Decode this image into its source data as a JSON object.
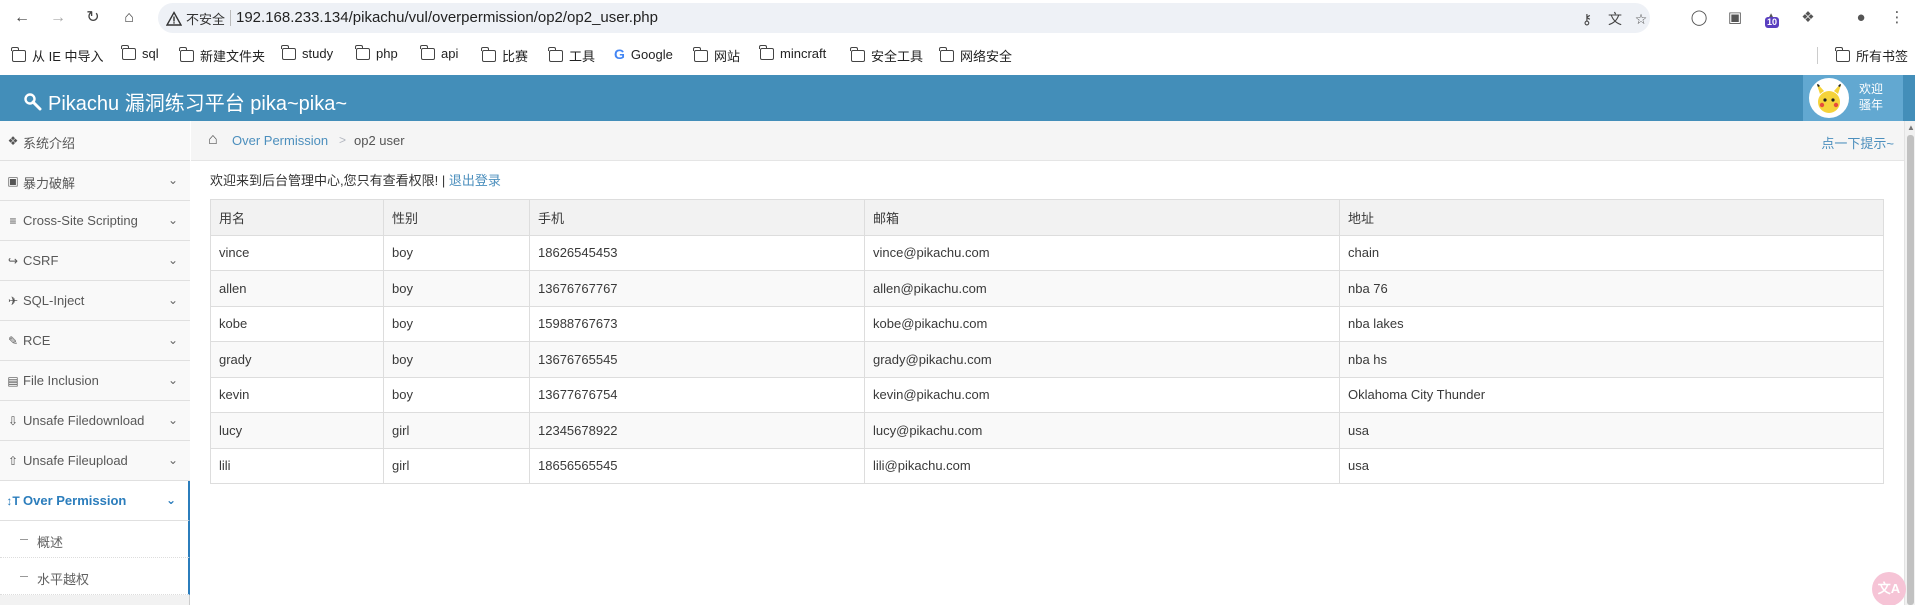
{
  "browser": {
    "url": "192.168.233.134/pikachu/vul/overpermission/op2/op2_user.php",
    "security_label": "不安全",
    "extension_badge": "10"
  },
  "bookmarks": [
    {
      "label": "从 IE 中导入",
      "icon": "folder-icon"
    },
    {
      "label": "sql",
      "icon": "folder-icon"
    },
    {
      "label": "新建文件夹",
      "icon": "folder-icon"
    },
    {
      "label": "study",
      "icon": "folder-icon"
    },
    {
      "label": "php",
      "icon": "folder-icon"
    },
    {
      "label": "api",
      "icon": "folder-icon"
    },
    {
      "label": "比赛",
      "icon": "folder-icon"
    },
    {
      "label": "工具",
      "icon": "folder-icon"
    },
    {
      "label": "Google",
      "icon": "google-icon"
    },
    {
      "label": "网站",
      "icon": "folder-icon"
    },
    {
      "label": "mincraft",
      "icon": "folder-icon"
    },
    {
      "label": "安全工具",
      "icon": "folder-icon"
    },
    {
      "label": "网络安全",
      "icon": "folder-icon"
    },
    {
      "label": "所有书签",
      "icon": "folder-icon"
    }
  ],
  "header": {
    "title": "Pikachu 漏洞练习平台 pika~pika~",
    "user_welcome_1": "欢迎",
    "user_welcome_2": "骚年",
    "brand_color": "#438eb9"
  },
  "sidebar": {
    "items": [
      {
        "label": "系统介绍",
        "icon": "tags-icon"
      },
      {
        "label": "暴力破解",
        "icon": "lock-icon"
      },
      {
        "label": "Cross-Site Scripting",
        "icon": "code-icon"
      },
      {
        "label": "CSRF",
        "icon": "share-icon"
      },
      {
        "label": "SQL-Inject",
        "icon": "plane-icon"
      },
      {
        "label": "RCE",
        "icon": "pencil-icon"
      },
      {
        "label": "File Inclusion",
        "icon": "file-icon"
      },
      {
        "label": "Unsafe Filedownload",
        "icon": "download-icon"
      },
      {
        "label": "Unsafe Fileupload",
        "icon": "upload-icon"
      },
      {
        "label": "Over Permission",
        "icon": "text-height-icon"
      }
    ],
    "sub_items": [
      {
        "label": "概述"
      },
      {
        "label": "水平越权"
      }
    ]
  },
  "breadcrumbs": {
    "section": "Over Permission",
    "current": "op2 user",
    "hint": "点一下提示~"
  },
  "main": {
    "welcome_text": "欢迎来到后台管理中心,您只有查看权限!",
    "separator": "|",
    "logout_link": "退出登录",
    "table": {
      "headers": [
        "用名",
        "性别",
        "手机",
        "邮箱",
        "地址"
      ],
      "rows": [
        [
          "vince",
          "boy",
          "18626545453",
          "vince@pikachu.com",
          "chain"
        ],
        [
          "allen",
          "boy",
          "13676767767",
          "allen@pikachu.com",
          "nba 76"
        ],
        [
          "kobe",
          "boy",
          "15988767673",
          "kobe@pikachu.com",
          "nba lakes"
        ],
        [
          "grady",
          "boy",
          "13676765545",
          "grady@pikachu.com",
          "nba hs"
        ],
        [
          "kevin",
          "boy",
          "13677676754",
          "kevin@pikachu.com",
          "Oklahoma City Thunder"
        ],
        [
          "lucy",
          "girl",
          "12345678922",
          "lucy@pikachu.com",
          "usa"
        ],
        [
          "lili",
          "girl",
          "18656565545",
          "lili@pikachu.com",
          "usa"
        ]
      ]
    }
  }
}
